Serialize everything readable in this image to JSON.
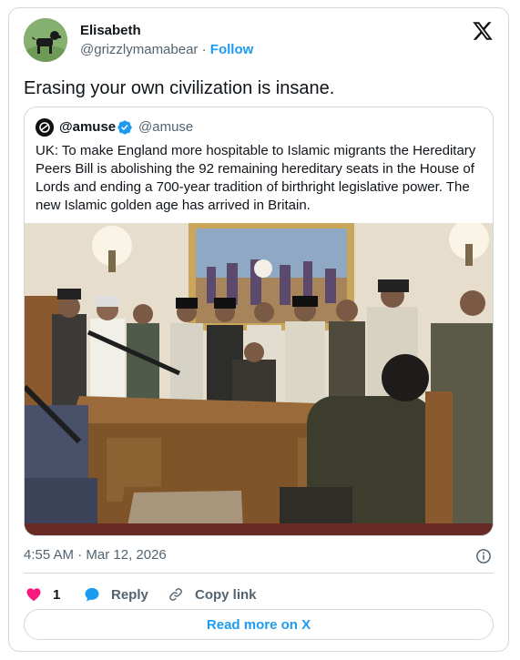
{
  "author": {
    "name": "Elisabeth",
    "handle": "@grizzlymamabear",
    "separator": "·",
    "follow_label": "Follow"
  },
  "tweet_text": "Erasing your own civilization is insane.",
  "quoted": {
    "name": "@amuse",
    "handle": "@amuse",
    "text": "UK: To make England more hospitable to Islamic migrants the Hereditary Peers Bill is abolishing the 92 remaining hereditary seats in the House of Lords and ending a 700-year tradition of birthright legislative power. The new Islamic golden age has arrived in Britain."
  },
  "meta": {
    "time": "4:55 AM",
    "separator": "·",
    "date": "Mar 12, 2026"
  },
  "actions": {
    "like_count": "1",
    "reply_label": "Reply",
    "copy_label": "Copy link"
  },
  "read_more_label": "Read more on X",
  "colors": {
    "accent": "#1d9bf0",
    "like": "#f91880",
    "border": "#cfd9de",
    "muted": "#536471"
  }
}
